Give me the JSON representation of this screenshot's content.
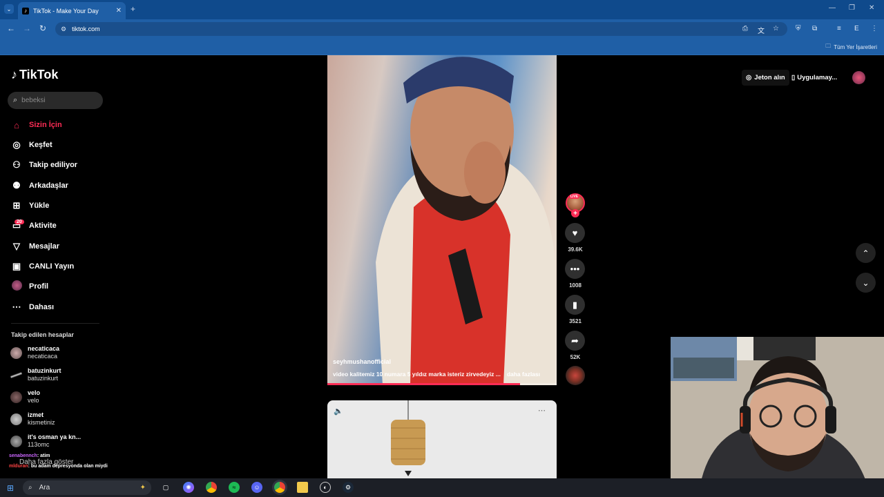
{
  "browser": {
    "tab_title": "TikTok - Make Your Day",
    "url": "tiktok.com",
    "bookmarks_all": "Tüm Yer İşaretleri"
  },
  "tiktok": {
    "logo": "TikTok",
    "search_placeholder": "bebeksi",
    "nav": [
      {
        "label": "Sizin İçin",
        "icon": "home-icon"
      },
      {
        "label": "Keşfet",
        "icon": "compass-icon"
      },
      {
        "label": "Takip ediliyor",
        "icon": "user-follow-icon"
      },
      {
        "label": "Arkadaşlar",
        "icon": "friends-icon"
      },
      {
        "label": "Yükle",
        "icon": "upload-icon"
      },
      {
        "label": "Aktivite",
        "icon": "activity-icon"
      },
      {
        "label": "Mesajlar",
        "icon": "messages-icon"
      },
      {
        "label": "CANLI Yayın",
        "icon": "live-icon"
      },
      {
        "label": "Profil",
        "icon": "profile-avatar"
      },
      {
        "label": "Dahası",
        "icon": "more-icon"
      }
    ],
    "activity_badge": "20",
    "following_title": "Takip edilen hesaplar",
    "following": [
      {
        "username": "necaticaca",
        "display": "necaticaca"
      },
      {
        "username": "batuzinkurt",
        "display": "batuzinkurt"
      },
      {
        "username": "velo",
        "display": "velo"
      },
      {
        "username": "izmet",
        "display": "kismetiniz"
      },
      {
        "username": "it's osman ya kn...",
        "display": "113omc"
      }
    ],
    "show_more": "Daha fazla göster",
    "top_right": {
      "get_coins": "Jeton alın",
      "get_app": "Uygulamay..."
    },
    "video": {
      "author": "seyhmushanofficial",
      "caption": "video kalitemiz 10 numara 5 yıldız marka isteriz zirvedeyiz ...",
      "more": "daha fazlası",
      "progress": 0.84,
      "live_label": "LIVE",
      "likes": "39.6K",
      "comments": "1008",
      "saves": "3521",
      "shares": "52K"
    }
  },
  "chat": [
    {
      "user": "senabennch",
      "message": ": atim"
    },
    {
      "user": "mlduran",
      "message": ": bu adam depresyonda olan miydi"
    }
  ],
  "taskbar": {
    "search": "Ara"
  }
}
